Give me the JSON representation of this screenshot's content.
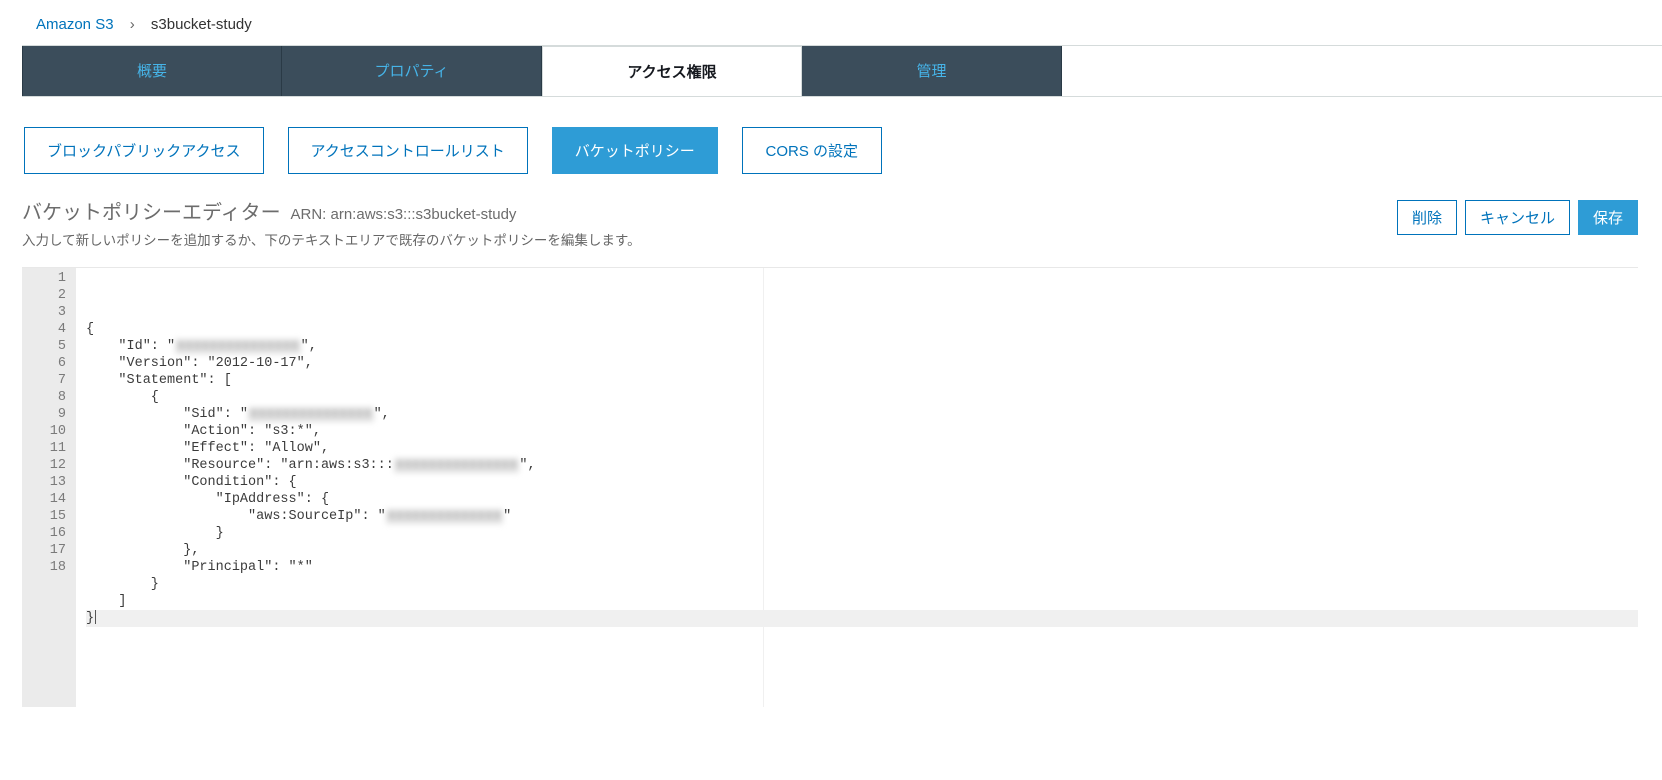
{
  "breadcrumb": {
    "root": "Amazon S3",
    "current": "s3bucket-study"
  },
  "tabs": [
    {
      "label": "概要"
    },
    {
      "label": "プロパティ"
    },
    {
      "label": "アクセス権限"
    },
    {
      "label": "管理"
    }
  ],
  "tabs_active_index": 2,
  "subtabs": [
    {
      "label": "ブロックパブリックアクセス"
    },
    {
      "label": "アクセスコントロールリスト"
    },
    {
      "label": "バケットポリシー"
    },
    {
      "label": "CORS の設定"
    }
  ],
  "subtabs_active_index": 2,
  "editor": {
    "title": "バケットポリシーエディター",
    "arn_label": "ARN: arn:aws:s3:::s3bucket-study",
    "subtitle": "入力して新しいポリシーを追加するか、下のテキストエリアで既存のバケットポリシーを編集します。"
  },
  "actions": {
    "delete": "削除",
    "cancel": "キャンセル",
    "save": "保存"
  },
  "code": {
    "total_lines": 18,
    "lines": [
      "{",
      "    \"Id\": \"████████████████\",",
      "    \"Version\": \"2012-10-17\",",
      "    \"Statement\": [",
      "        {",
      "            \"Sid\": \"██████████████████\",",
      "            \"Action\": \"s3:*\",",
      "            \"Effect\": \"Allow\",",
      "            \"Resource\": \"arn:aws:s3:::███████████████\",",
      "            \"Condition\": {",
      "                \"IpAddress\": {",
      "                    \"aws:SourceIp\": \"██████████████\"",
      "                }",
      "            },",
      "            \"Principal\": \"*\"",
      "        }",
      "    ]",
      "}"
    ],
    "highlighted_line_index": 17
  }
}
